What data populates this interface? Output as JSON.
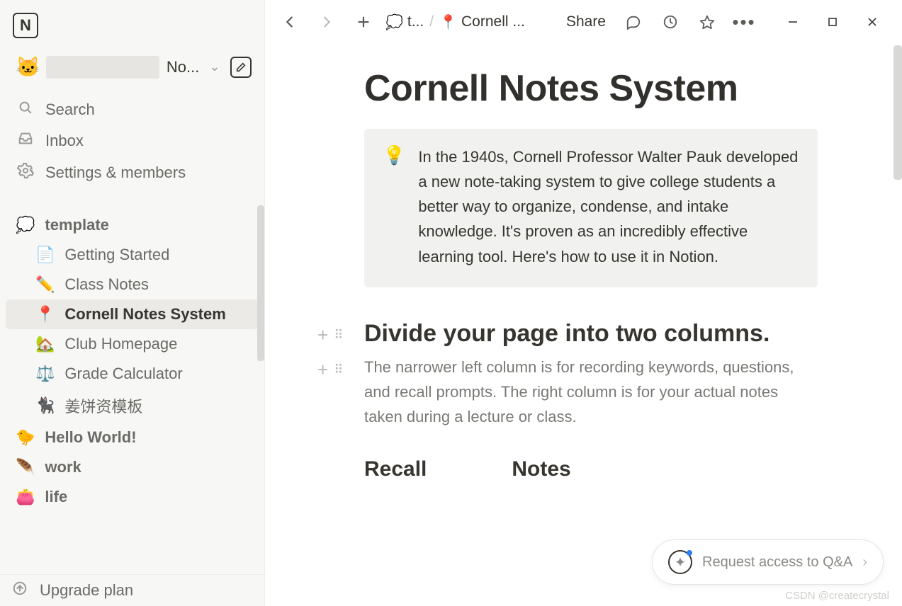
{
  "workspace": {
    "icon": "🐱",
    "truncated_label": "No..."
  },
  "sidebar": {
    "search": "Search",
    "inbox": "Inbox",
    "settings": "Settings & members",
    "upgrade": "Upgrade plan",
    "template_section": {
      "icon": "💭",
      "label": "template",
      "children": [
        {
          "icon": "📄",
          "label": "Getting Started"
        },
        {
          "icon": "✏️",
          "label": "Class Notes"
        },
        {
          "icon": "📍",
          "label": "Cornell Notes System",
          "active": true
        },
        {
          "icon": "🏡",
          "label": "Club Homepage"
        },
        {
          "icon": "⚖️",
          "label": "Grade Calculator"
        },
        {
          "icon": "🐈‍⬛",
          "label": "姜饼资模板"
        }
      ]
    },
    "pages": [
      {
        "icon": "🐤",
        "label": "Hello World!"
      },
      {
        "icon": "🪶",
        "label": "work"
      },
      {
        "icon": "👛",
        "label": "life"
      }
    ]
  },
  "breadcrumb": {
    "parent_icon": "💭",
    "parent_label": "t...",
    "current_icon": "📍",
    "current_label": "Cornell ..."
  },
  "topbar": {
    "share": "Share"
  },
  "page": {
    "title": "Cornell Notes System",
    "callout_icon": "💡",
    "callout_text": "In the 1940s, Cornell Professor Walter Pauk developed a new note-taking system to give college students a better way to organize, condense, and intake knowledge. It's proven as an incredibly effective learning tool. Here's how to use it in Notion.",
    "heading": "Divide your page into two columns.",
    "paragraph": "The narrower left column is for recording keywords, questions, and recall prompts. The right column is for your actual notes taken during a lecture or class.",
    "col_recall": "Recall",
    "col_notes": "Notes"
  },
  "qa": {
    "label": "Request access to Q&A"
  },
  "watermark": "CSDN @createcrystal"
}
